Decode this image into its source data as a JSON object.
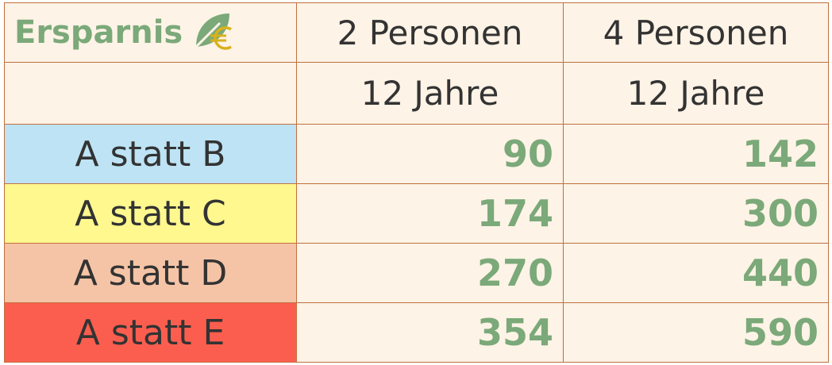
{
  "header": {
    "title": "Ersparnis",
    "title_icon": "leaf-euro-icon",
    "columns": [
      "2 Personen",
      "4 Personen"
    ],
    "subheaders": [
      "12 Jahre",
      "12 Jahre"
    ]
  },
  "rows": [
    {
      "label": "A statt B",
      "values": [
        "90",
        "142"
      ],
      "color": "#bde3f5"
    },
    {
      "label": "A statt C",
      "values": [
        "174",
        "300"
      ],
      "color": "#fff88f"
    },
    {
      "label": "A statt D",
      "values": [
        "270",
        "440"
      ],
      "color": "#f5c4a6"
    },
    {
      "label": "A statt E",
      "values": [
        "354",
        "590"
      ],
      "color": "#fb5e4f"
    }
  ],
  "colors": {
    "accent_green": "#7ba979",
    "border": "#c0703f",
    "cell_bg": "#fdf3e6",
    "euro_gold": "#d9b21a"
  }
}
